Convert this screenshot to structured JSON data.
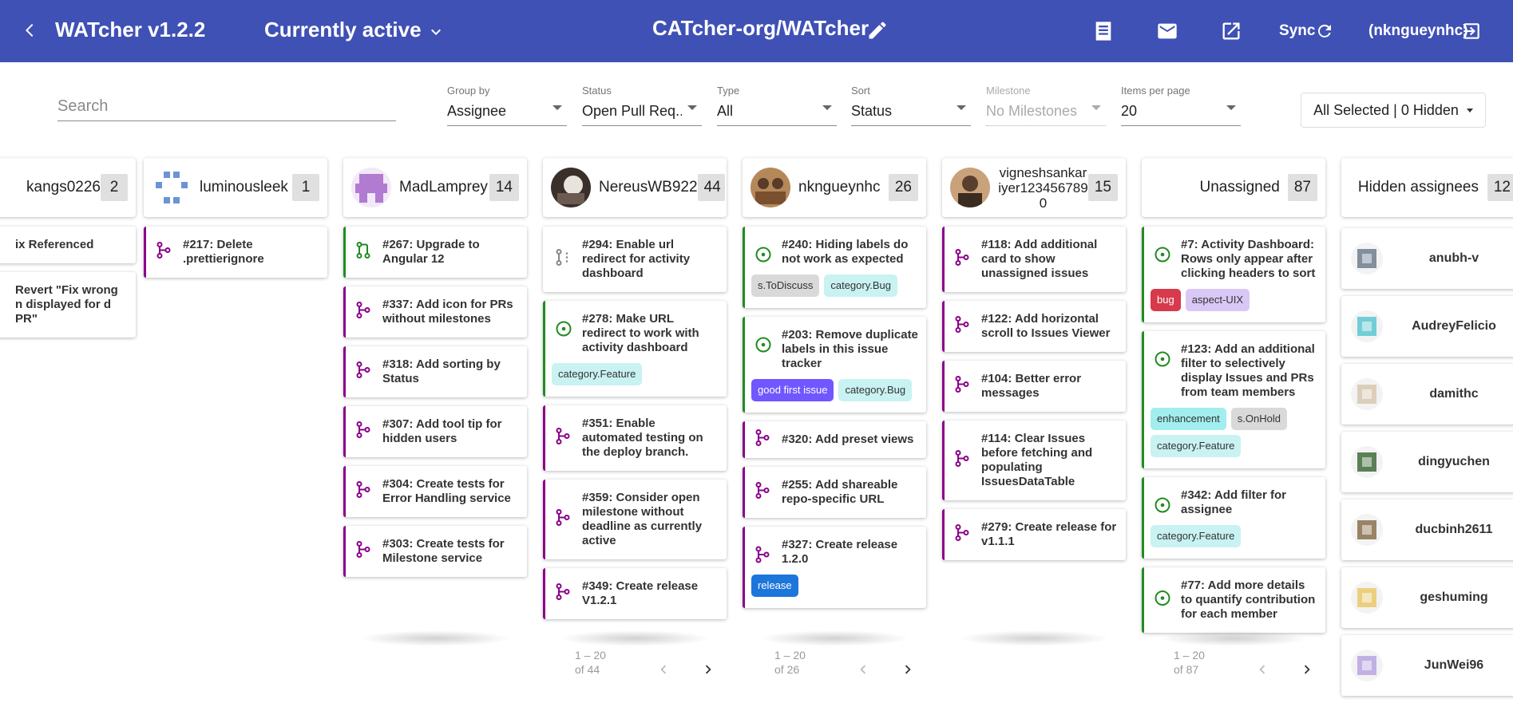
{
  "header": {
    "app_title": "WATcher v1.2.2",
    "view_select": "Currently active",
    "repo": "CATcher-org/WATcher",
    "sync_label": "Sync",
    "user": "(nkngueynhc)"
  },
  "filters": {
    "search_placeholder": "Search",
    "group_by": {
      "label": "Group by",
      "value": "Assignee"
    },
    "status": {
      "label": "Status",
      "value": "Open Pull Req..."
    },
    "type": {
      "label": "Type",
      "value": "All"
    },
    "sort": {
      "label": "Sort",
      "value": "Status"
    },
    "milestone": {
      "label": "Milestone",
      "value": "No Milestones"
    },
    "items_per_page": {
      "label": "Items per page",
      "value": "20"
    },
    "labels_select": "All Selected | 0 Hidden"
  },
  "colors": {
    "primary": "#3f51b5",
    "pr_purple": "#8b008b",
    "issue_green": "#228b22"
  },
  "columns": [
    {
      "name": "kangs0226",
      "count": "2",
      "cards": [
        {
          "title": "ix Referenced",
          "type": "pr"
        },
        {
          "title": "Revert \"Fix wrong n displayed for d PR\"",
          "type": "pr"
        }
      ]
    },
    {
      "name": "luminousleek",
      "count": "1",
      "cards": [
        {
          "title": "#217: Delete .prettierignore",
          "type": "pr"
        }
      ]
    },
    {
      "name": "MadLamprey",
      "count": "14",
      "cards": [
        {
          "title": "#267: Upgrade to Angular 12",
          "type": "pr-merged"
        },
        {
          "title": "#337: Add icon for PRs without milestones",
          "type": "pr"
        },
        {
          "title": "#318: Add sorting by Status",
          "type": "pr"
        },
        {
          "title": "#307: Add tool tip for hidden users",
          "type": "pr"
        },
        {
          "title": "#304: Create tests for Error Handling service",
          "type": "pr"
        },
        {
          "title": "#303: Create tests for Milestone service",
          "type": "pr"
        }
      ]
    },
    {
      "name": "NereusWB922",
      "count": "44",
      "cards": [
        {
          "title": "#294: Enable url redirect for activity dashboard",
          "type": "draft"
        },
        {
          "title": "#278: Make URL redirect to work with activity dashboard",
          "type": "issue",
          "labels": [
            "category.Feature"
          ]
        },
        {
          "title": "#351: Enable automated testing on the deploy branch.",
          "type": "pr"
        },
        {
          "title": "#359: Consider open milestone without deadline as currently active",
          "type": "pr"
        },
        {
          "title": "#349: Create release V1.2.1",
          "type": "pr"
        }
      ],
      "pager": {
        "range": "1 – 20 of 44"
      }
    },
    {
      "name": "nkngueynhc",
      "count": "26",
      "cards": [
        {
          "title": "#240: Hiding labels do not work as expected",
          "type": "issue",
          "labels": [
            "s.ToDiscuss",
            "category.Bug"
          ]
        },
        {
          "title": "#203: Remove duplicate labels in this issue tracker",
          "type": "issue",
          "labels": [
            "good first issue",
            "category.Bug"
          ]
        },
        {
          "title": "#320: Add preset views",
          "type": "pr"
        },
        {
          "title": "#255: Add shareable repo-specific URL",
          "type": "pr"
        },
        {
          "title": "#327: Create release 1.2.0",
          "type": "pr",
          "labels": [
            "release"
          ]
        }
      ],
      "pager": {
        "range": "1 – 20 of 26"
      }
    },
    {
      "name": "vigneshsankariyer1234567890",
      "count": "15",
      "cards": [
        {
          "title": "#118: Add additional card to show unassigned issues",
          "type": "pr"
        },
        {
          "title": "#122: Add horizontal scroll to Issues Viewer",
          "type": "pr"
        },
        {
          "title": "#104: Better error messages",
          "type": "pr"
        },
        {
          "title": "#114: Clear Issues before fetching and populating IssuesDataTable",
          "type": "pr"
        },
        {
          "title": "#279: Create release for v1.1.1",
          "type": "pr"
        }
      ]
    },
    {
      "name": "Unassigned",
      "count": "87",
      "cards": [
        {
          "title": "#7: Activity Dashboard: Rows only appear after clicking headers to sort",
          "type": "issue",
          "labels": [
            "bug",
            "aspect-UIX"
          ]
        },
        {
          "title": "#123: Add an additional filter to selectively display Issues and PRs from team members",
          "type": "issue",
          "labels": [
            "enhancement",
            "s.OnHold",
            "category.Feature"
          ]
        },
        {
          "title": "#342: Add filter for assignee",
          "type": "issue",
          "labels": [
            "category.Feature"
          ]
        },
        {
          "title": "#77: Add more details to quantify contribution for each member",
          "type": "issue"
        }
      ],
      "pager": {
        "range": "1 – 20 of 87"
      }
    }
  ],
  "label_colors": {
    "category.Feature": "#c9f2f2",
    "category.Bug": "#c9f2f2",
    "s.ToDiscuss": "#d9d9d9",
    "s.OnHold": "#d9d9d9",
    "good first issue": "#7057ff",
    "release": "#1d76db",
    "bug": "#d73a4a",
    "aspect-UIX": "#d9c8f5",
    "enhancement": "#a2eeef"
  },
  "hidden": {
    "title": "Hidden assignees",
    "count": "12",
    "users": [
      "anubh-v",
      "AudreyFelicio",
      "damithc",
      "dingyuchen",
      "ducbinh2611",
      "geshuming",
      "JunWei96"
    ]
  }
}
